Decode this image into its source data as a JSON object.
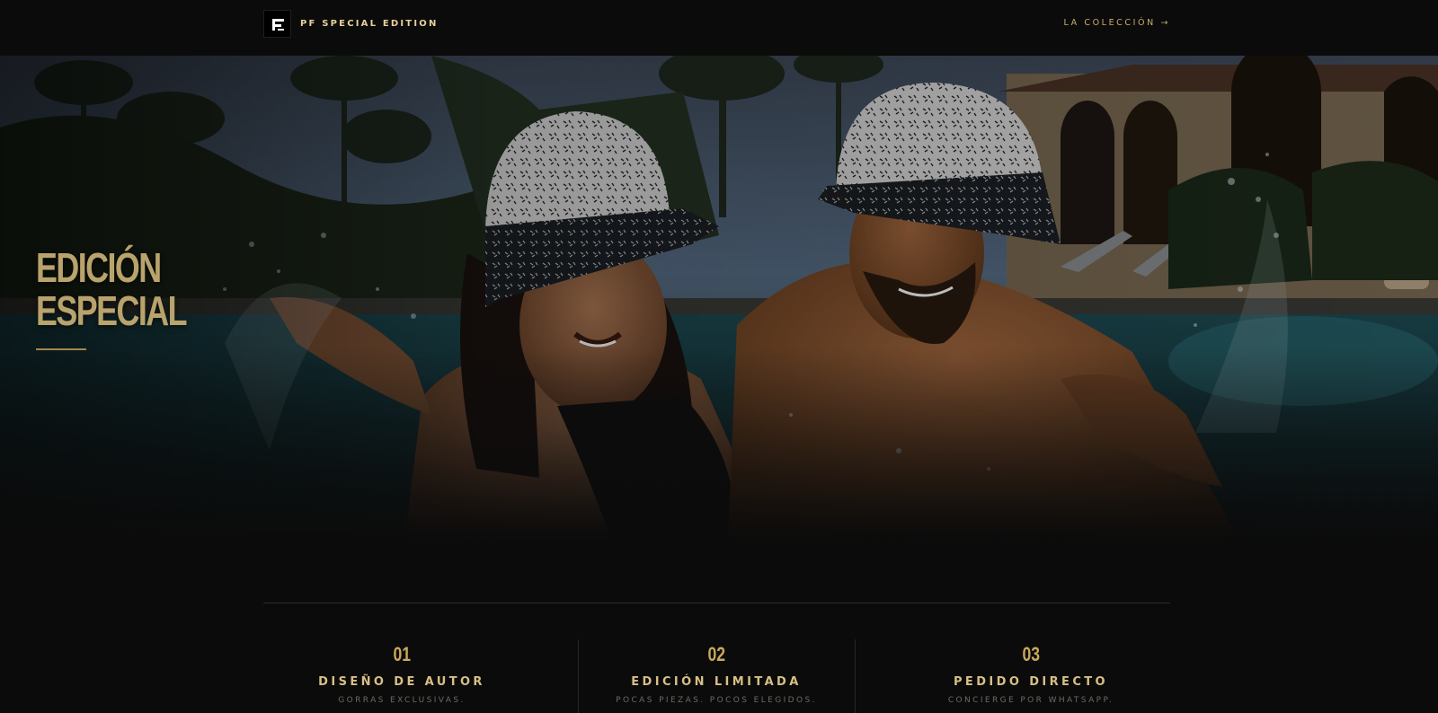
{
  "header": {
    "brand_name": "PF SPECIAL EDITION",
    "nav_link": "LA COLECCIÓN →"
  },
  "hero": {
    "title_line1": "EDICIÓN",
    "title_line2": "ESPECIAL",
    "image": "two-people-in-pool-wearing-bucket-hats"
  },
  "features": [
    {
      "num": "01",
      "title": "DISEÑO DE AUTOR",
      "desc": "GORRAS EXCLUSIVAS."
    },
    {
      "num": "02",
      "title": "EDICIÓN LIMITADA",
      "desc": "POCAS PIEZAS. POCOS ELEGIDOS."
    },
    {
      "num": "03",
      "title": "PEDIDO DIRECTO",
      "desc": "CONCIERGE POR WHATSAPP."
    }
  ],
  "colors": {
    "background": "#0b0b0b",
    "gold": "#c9a95a",
    "gold_light": "#e7d09a",
    "muted": "#6f6a60"
  }
}
